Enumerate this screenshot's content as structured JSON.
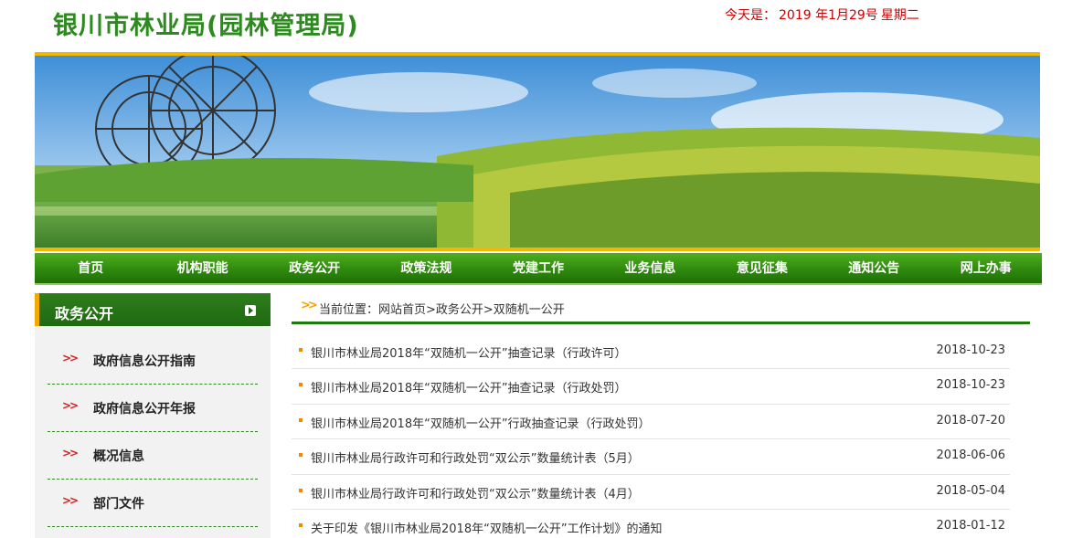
{
  "header": {
    "site_title": "银川市林业局(园林管理局)",
    "date_prefix": "今天是：",
    "date": "2019 年1月29号",
    "weekday": "星期二"
  },
  "nav": {
    "items": [
      {
        "label": "首页"
      },
      {
        "label": "机构职能"
      },
      {
        "label": "政务公开"
      },
      {
        "label": "政策法规"
      },
      {
        "label": "党建工作"
      },
      {
        "label": "业务信息"
      },
      {
        "label": "意见征集"
      },
      {
        "label": "通知公告"
      },
      {
        "label": "网上办事"
      }
    ]
  },
  "sidebar": {
    "title": "政务公开",
    "items": [
      {
        "label": "政府信息公开指南"
      },
      {
        "label": "政府信息公开年报"
      },
      {
        "label": "概况信息"
      },
      {
        "label": "部门文件"
      }
    ]
  },
  "breadcrumb": {
    "text": "当前位置：网站首页>政务公开>双随机一公开"
  },
  "articles": [
    {
      "title": "银川市林业局2018年“双随机一公开”抽查记录（行政许可）",
      "date": "2018-10-23"
    },
    {
      "title": "银川市林业局2018年“双随机一公开”抽查记录（行政处罚）",
      "date": "2018-10-23"
    },
    {
      "title": "银川市林业局2018年“双随机一公开”行政抽查记录（行政处罚）",
      "date": "2018-07-20"
    },
    {
      "title": "银川市林业局行政许可和行政处罚“双公示”数量统计表（5月）",
      "date": "2018-06-06"
    },
    {
      "title": "银川市林业局行政许可和行政处罚“双公示”数量统计表（4月）",
      "date": "2018-05-04"
    },
    {
      "title": "关于印发《银川市林业局2018年“双随机一公开”工作计划》的通知",
      "date": "2018-01-12"
    }
  ],
  "colors": {
    "brand_green": "#2d8a1e",
    "nav_green": "#2f8a0e",
    "date_red": "#cc0000",
    "accent_orange": "#f2a200"
  }
}
